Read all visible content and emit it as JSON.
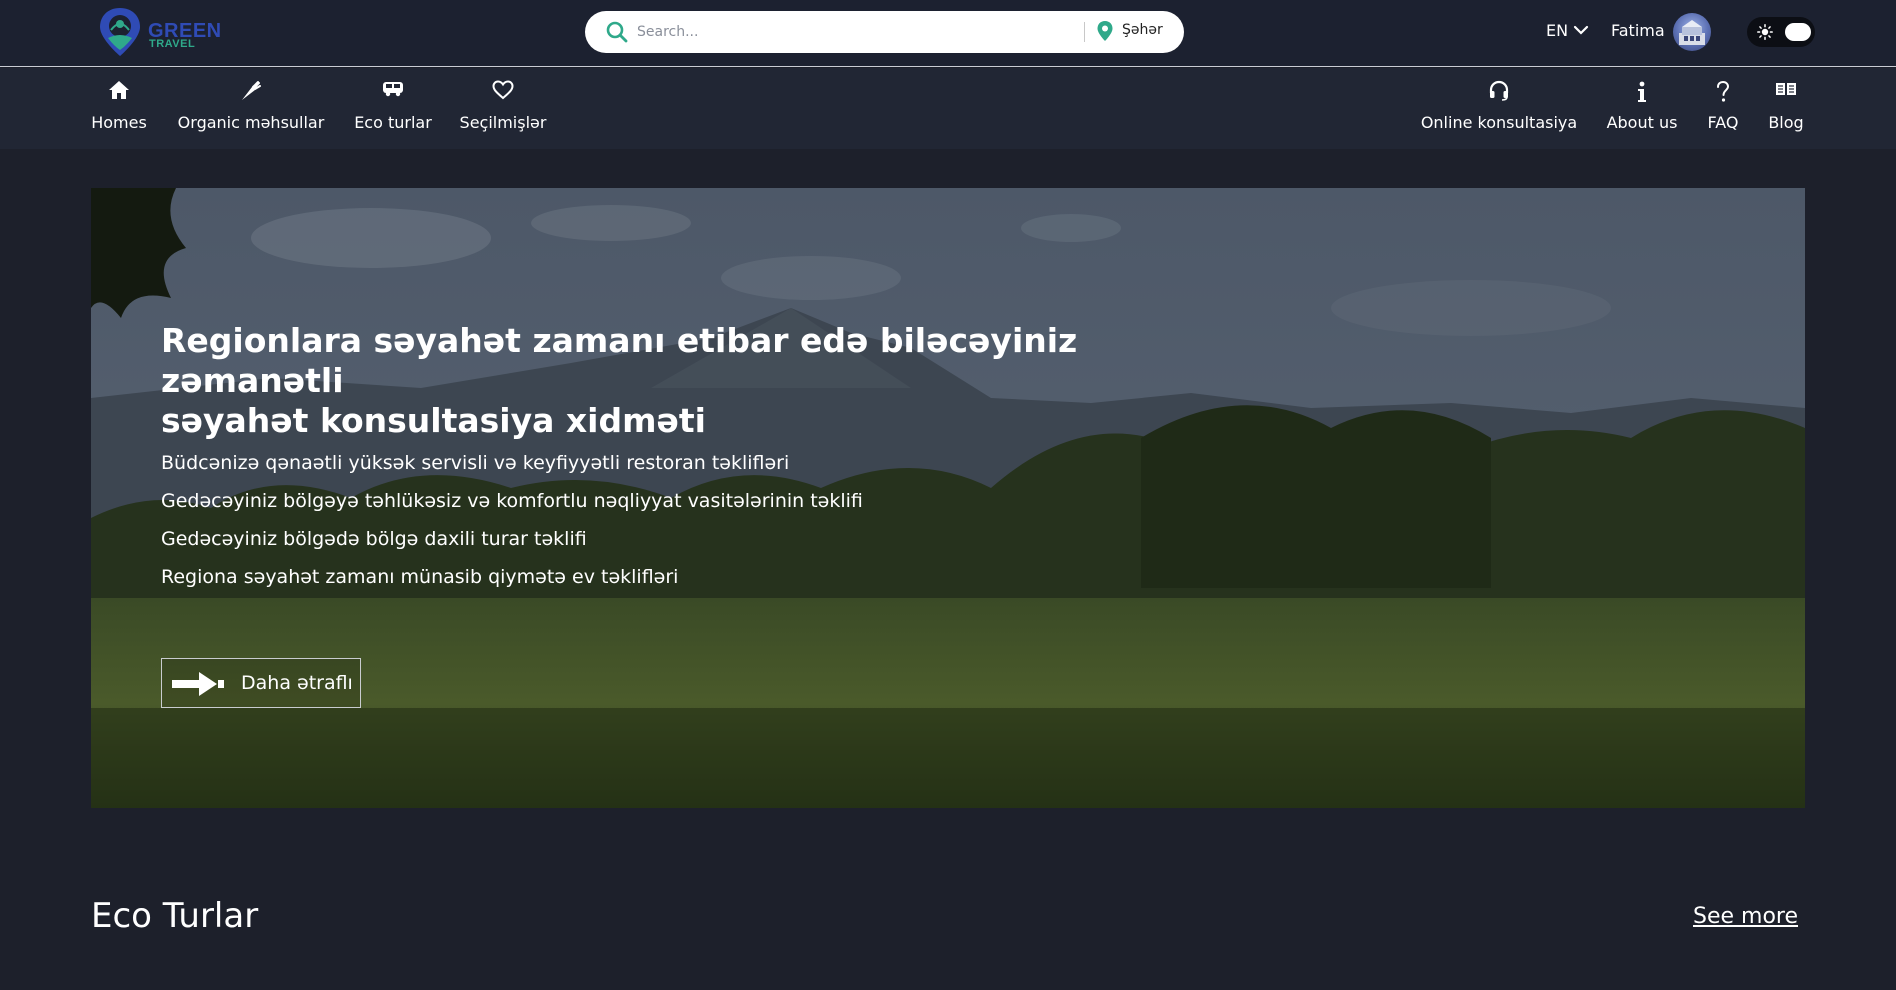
{
  "header": {
    "logo": {
      "line1": "GREEN",
      "line2": "TRAVEL"
    },
    "search": {
      "placeholder": "Search...",
      "value": "",
      "city_label": "Şəhər"
    },
    "language": "EN",
    "user_name": "Fatima",
    "theme": "dark"
  },
  "nav": {
    "left": [
      {
        "label": "Homes",
        "icon": "home-icon"
      },
      {
        "label": "Organic məhsullar",
        "icon": "carrot-icon"
      },
      {
        "label": "Eco turlar",
        "icon": "bus-icon"
      },
      {
        "label": "Seçilmişlər",
        "icon": "heart-icon"
      }
    ],
    "right": [
      {
        "label": "Online konsultasiya",
        "icon": "headset-icon"
      },
      {
        "label": "About us",
        "icon": "info-icon"
      },
      {
        "label": "FAQ",
        "icon": "question-icon"
      },
      {
        "label": "Blog",
        "icon": "book-icon"
      }
    ]
  },
  "hero": {
    "title_line1": "Regionlara səyahət zamanı etibar edə biləcəyiniz zəmanətli",
    "title_line2": "səyahət konsultasiya xidməti",
    "features": [
      "Büdcənizə qənaətli yüksək servisli və keyfiyyətli restoran təklifləri",
      "Gedəcəyiniz bölgəyə təhlükəsiz və komfortlu nəqliyyat vasitələrinin təklifi",
      "Gedəcəyiniz bölgədə bölgə daxili turar təklifi",
      "Regiona səyahət zamanı münasib qiymətə ev təklifləri"
    ],
    "button_label": "Daha ətraflı"
  },
  "eco_tours": {
    "title": "Eco Turlar",
    "see_more": "See more"
  },
  "colors": {
    "page_bg": "#1d202b",
    "topbar_bg": "#1c2130",
    "navbar_bg": "#212634",
    "accent_teal": "#2fa98a",
    "logo_blue": "#2f4bb5"
  }
}
